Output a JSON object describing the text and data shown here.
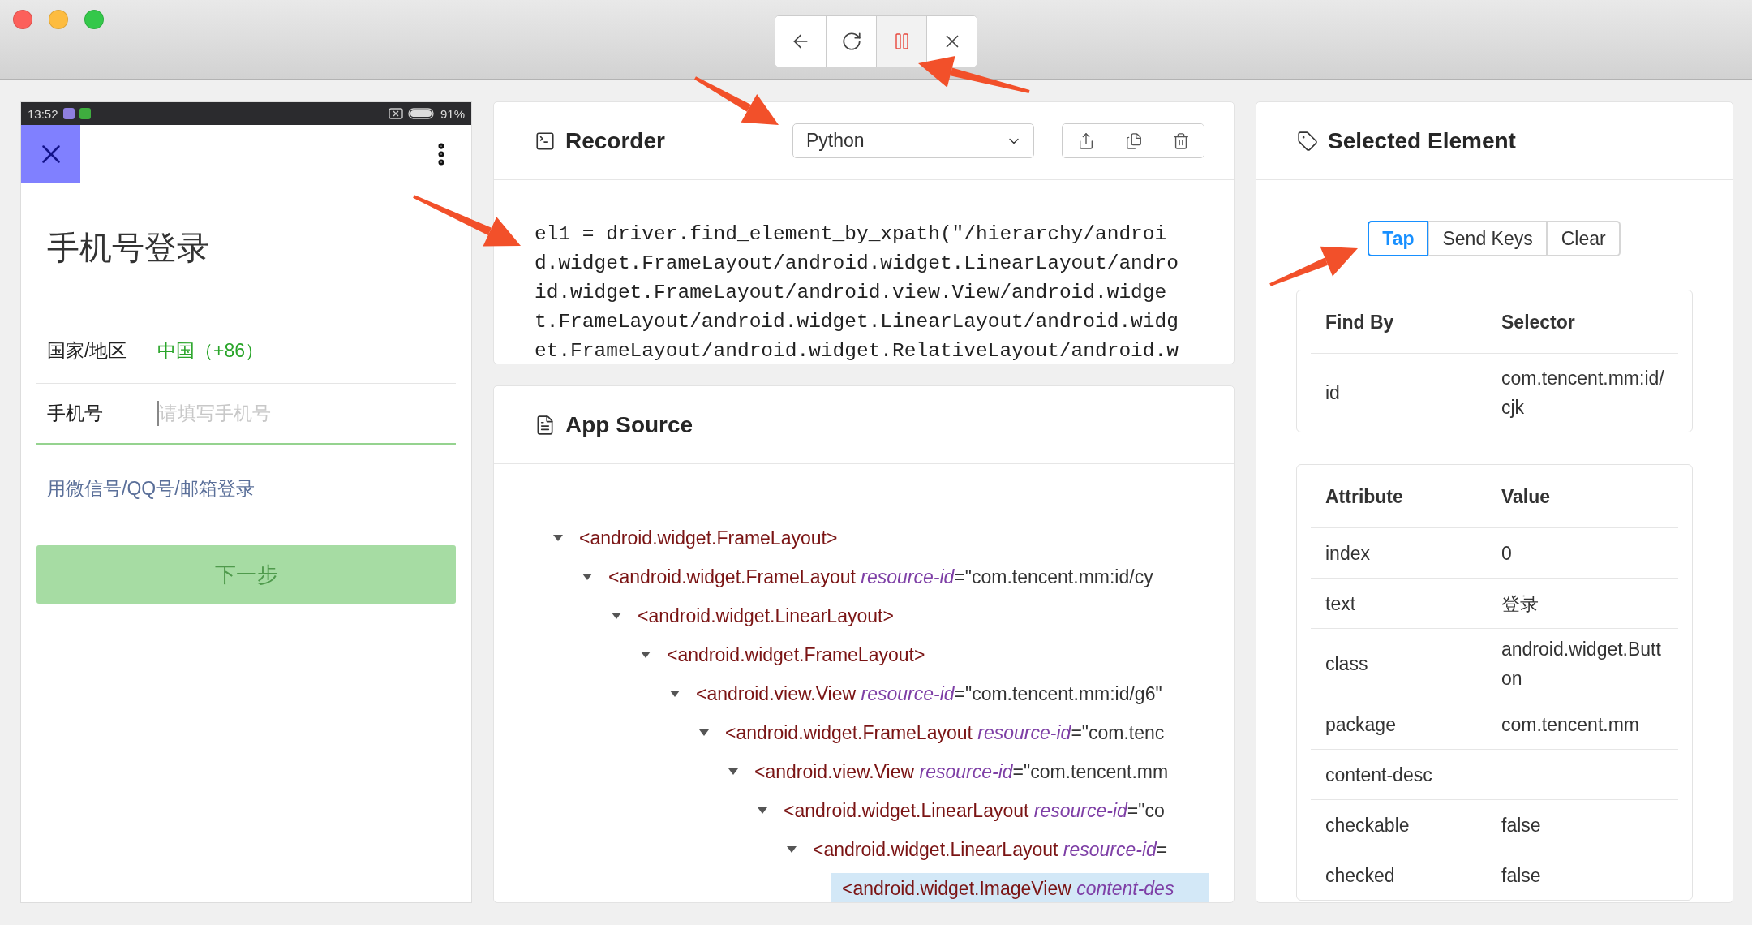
{
  "window": {
    "toolbar": {
      "recording": true
    }
  },
  "device": {
    "status_bar": {
      "time": "13:52",
      "battery": "91%"
    },
    "screen": {
      "title": "手机号登录",
      "country_label": "国家/地区",
      "country_value": "中国（+86）",
      "phone_label": "手机号",
      "phone_placeholder": "请填写手机号",
      "alt_login_link": "用微信号/QQ号/邮箱登录",
      "next_button": {
        "label": "下一步",
        "disabled": true
      }
    }
  },
  "recorder": {
    "title": "Recorder",
    "language": "Python",
    "code": "el1 = driver.find_element_by_xpath(\"/hierarchy/android.widget.FrameLayout/android.widget.LinearLayout/android.widget.FrameLayout/android.view.View/android.widget.FrameLayout/android.widget.LinearLayout/android.widget.FrameLayout/android.widget.RelativeLayout/android.w"
  },
  "app_source": {
    "title": "App Source",
    "tree": [
      {
        "tag": "<android.widget.FrameLayout>",
        "expanded": true,
        "selected": false,
        "children": [
          {
            "tag": "<android.widget.FrameLayout",
            "attribute": "resource-id",
            "value": "=\"com.tencent.mm:id/cy",
            "expanded": true,
            "selected": false,
            "children": [
              {
                "tag": "<android.widget.LinearLayout>",
                "expanded": true,
                "selected": false,
                "children": [
                  {
                    "tag": "<android.widget.FrameLayout>",
                    "expanded": true,
                    "selected": false,
                    "children": [
                      {
                        "tag": "<android.view.View",
                        "attribute": "resource-id",
                        "value": "=\"com.tencent.mm:id/g6\"",
                        "expanded": true,
                        "selected": false,
                        "children": [
                          {
                            "tag": "<android.widget.FrameLayout",
                            "attribute": "resource-id",
                            "value": "=\"com.tenc",
                            "expanded": true,
                            "selected": false,
                            "children": [
                              {
                                "tag": "<android.view.View",
                                "attribute": "resource-id",
                                "value": "=\"com.tencent.mm",
                                "expanded": true,
                                "selected": false,
                                "children": [
                                  {
                                    "tag": "<android.widget.LinearLayout",
                                    "attribute": "resource-id",
                                    "value": "=\"co",
                                    "expanded": true,
                                    "selected": false,
                                    "children": [
                                      {
                                        "tag": "<android.widget.LinearLayout",
                                        "attribute": "resource-id",
                                        "value": "=",
                                        "expanded": true,
                                        "selected": false,
                                        "children": [
                                          {
                                            "tag": "<android.widget.ImageView",
                                            "attribute": "content-des",
                                            "selected": true
                                          }
                                        ]
                                      }
                                    ]
                                  }
                                ]
                              }
                            ]
                          }
                        ]
                      }
                    ]
                  }
                ]
              }
            ]
          }
        ]
      }
    ]
  },
  "selected_element": {
    "title": "Selected Element",
    "actions": [
      {
        "label": "Tap",
        "selected": true
      },
      {
        "label": "Send Keys",
        "selected": false
      },
      {
        "label": "Clear",
        "selected": false
      }
    ],
    "find_by": {
      "columns": [
        "Find By",
        "Selector"
      ],
      "rows": [
        {
          "strategy": "id",
          "selector": "com.tencent.mm:id/cjk"
        }
      ]
    },
    "attributes": {
      "columns": [
        "Attribute",
        "Value"
      ],
      "rows": [
        {
          "name": "index",
          "value": "0"
        },
        {
          "name": "text",
          "value": "登录"
        },
        {
          "name": "class",
          "value": "android.widget.Button"
        },
        {
          "name": "package",
          "value": "com.tencent.mm"
        },
        {
          "name": "content-desc"
        },
        {
          "name": "checkable",
          "value": "false"
        },
        {
          "name": "checked",
          "value": "false"
        }
      ]
    }
  }
}
